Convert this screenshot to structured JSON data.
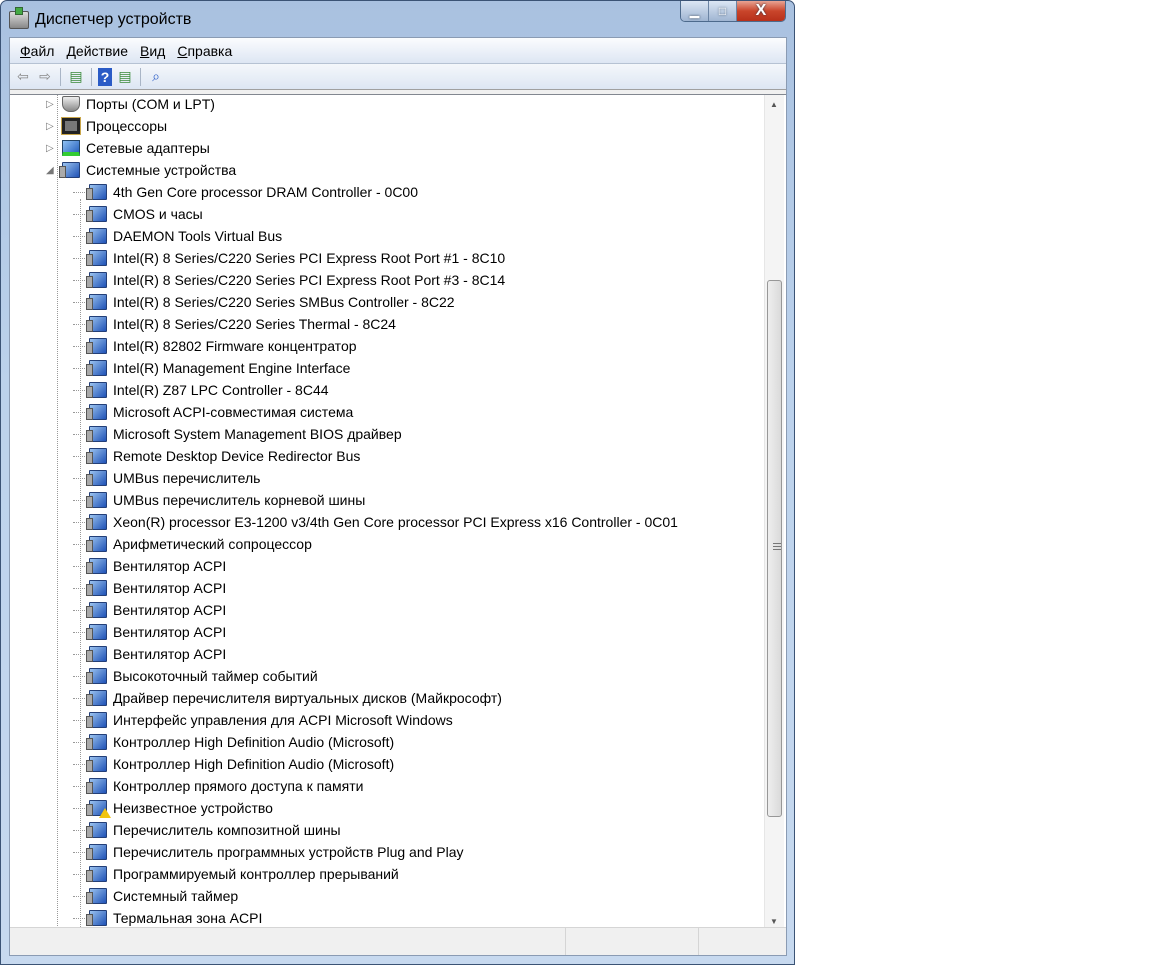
{
  "window": {
    "title": "Диспетчер устройств",
    "minimize": "▁",
    "maximize": "□",
    "close": "X"
  },
  "menu": [
    "Файл",
    "Действие",
    "Вид",
    "Справка"
  ],
  "toolbar": [
    {
      "icon": "back-icon",
      "glyph": "⇦"
    },
    {
      "icon": "forward-icon",
      "glyph": "⇨"
    },
    {
      "icon": "show-hide-console-tree-icon",
      "glyph": "▤"
    },
    {
      "icon": "help-icon",
      "glyph": "?"
    },
    {
      "icon": "properties-icon",
      "glyph": "▤"
    },
    {
      "icon": "scan-hardware-icon",
      "glyph": "⌕"
    }
  ],
  "tree": {
    "categories": [
      {
        "label": "Порты (COM и LPT)",
        "icon": "port",
        "expanded": false
      },
      {
        "label": "Процессоры",
        "icon": "cpu",
        "expanded": false
      },
      {
        "label": "Сетевые адаптеры",
        "icon": "net",
        "expanded": false
      },
      {
        "label": "Системные устройства",
        "icon": "sys",
        "expanded": true
      }
    ],
    "children": [
      "4th Gen Core processor DRAM Controller - 0C00",
      "CMOS и часы",
      "DAEMON Tools Virtual Bus",
      "Intel(R) 8 Series/C220 Series PCI Express Root Port #1 - 8C10",
      "Intel(R) 8 Series/C220 Series PCI Express Root Port #3 - 8C14",
      "Intel(R) 8 Series/C220 Series SMBus Controller - 8C22",
      "Intel(R) 8 Series/C220 Series Thermal - 8C24",
      "Intel(R) 82802 Firmware концентратор",
      "Intel(R) Management Engine Interface",
      "Intel(R) Z87 LPC Controller - 8C44",
      "Microsoft ACPI-совместимая система",
      "Microsoft System Management BIOS драйвер",
      "Remote Desktop Device Redirector Bus",
      "UMBus перечислитель",
      "UMBus перечислитель корневой шины",
      "Xeon(R) processor E3-1200 v3/4th Gen Core processor PCI Express x16 Controller - 0C01",
      "Арифметический сопроцессор",
      "Вентилятор ACPI",
      "Вентилятор ACPI",
      "Вентилятор ACPI",
      "Вентилятор ACPI",
      "Вентилятор ACPI",
      "Высокоточный таймер событий",
      "Драйвер перечислителя виртуальных дисков (Майкрософт)",
      "Интерфейс управления для ACPI Microsoft Windows",
      "Контроллер High Definition Audio (Microsoft)",
      "Контроллер High Definition Audio (Microsoft)",
      "Контроллер прямого доступа к памяти",
      "Неизвестное устройство",
      "Перечислитель композитной шины",
      "Перечислитель программных устройств Plug and Play",
      "Программируемый контроллер прерываний",
      "Системный таймер",
      "Термальная зона ACPI"
    ],
    "warning_item": "Неизвестное устройство"
  }
}
